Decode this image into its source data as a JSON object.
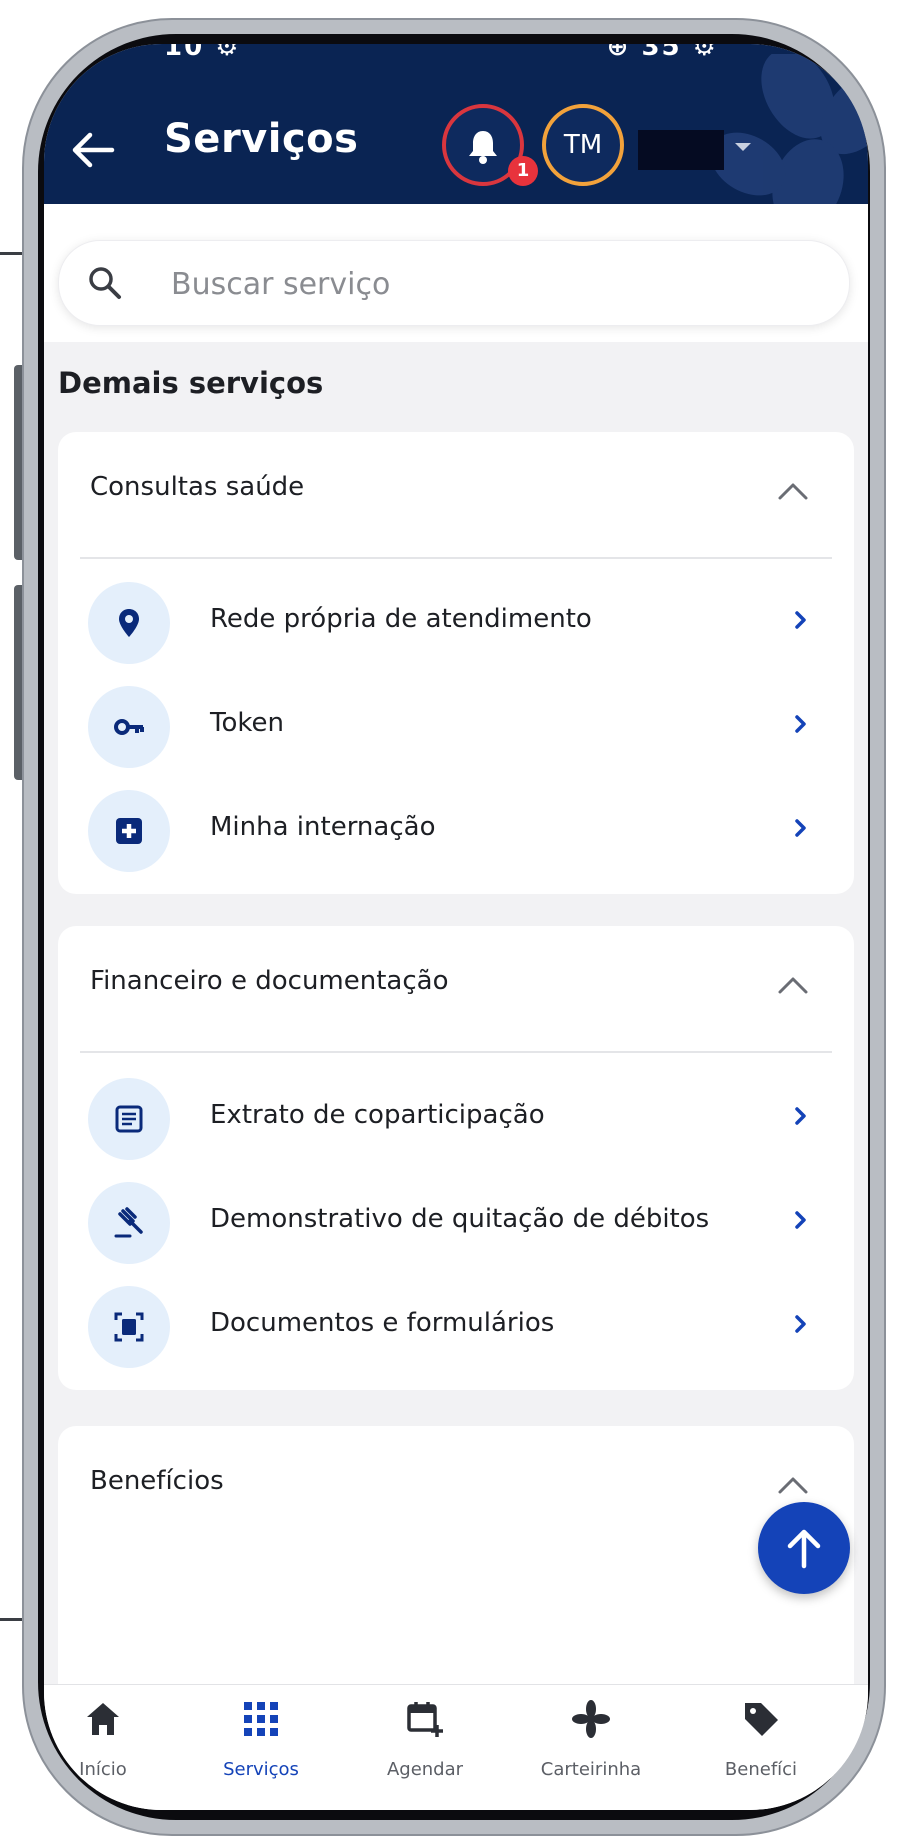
{
  "status_bar": {
    "left": "10 ⚙",
    "right": "⊕ 35 ⚙"
  },
  "header": {
    "title": "Serviços",
    "notification_count": "1",
    "avatar_initials": "TM",
    "colors": {
      "background": "#0a2453",
      "bell_ring": "#d9363e",
      "avatar_ring": "#f2a23b"
    }
  },
  "search": {
    "placeholder": "Buscar serviço",
    "value": ""
  },
  "section_title": "Demais serviços",
  "groups": [
    {
      "title": "Consultas saúde",
      "items": [
        {
          "label": "Rede própria de atendimento",
          "icon": "location-pin-icon"
        },
        {
          "label": "Token",
          "icon": "key-icon"
        },
        {
          "label": "Minha internação",
          "icon": "medical-cross-icon"
        }
      ]
    },
    {
      "title": "Financeiro e documentação",
      "items": [
        {
          "label": "Extrato de coparticipação",
          "icon": "statement-icon"
        },
        {
          "label": "Demonstrativo de quitação de débitos",
          "icon": "gavel-icon"
        },
        {
          "label": "Documentos e formulários",
          "icon": "document-scan-icon"
        }
      ]
    },
    {
      "title": "Benefícios",
      "items": []
    }
  ],
  "bottom_nav": [
    {
      "label": "Início",
      "icon": "home-icon",
      "active": false
    },
    {
      "label": "Serviços",
      "icon": "grid-icon",
      "active": true
    },
    {
      "label": "Agendar",
      "icon": "calendar-add-icon",
      "active": false
    },
    {
      "label": "Carteirinha",
      "icon": "card-flower-icon",
      "active": false
    },
    {
      "label": "Benefíci",
      "icon": "tag-icon",
      "active": false
    }
  ],
  "colors": {
    "accent": "#1443b8",
    "icon_bg": "#e4effb",
    "icon_fg": "#0a2a7a"
  }
}
